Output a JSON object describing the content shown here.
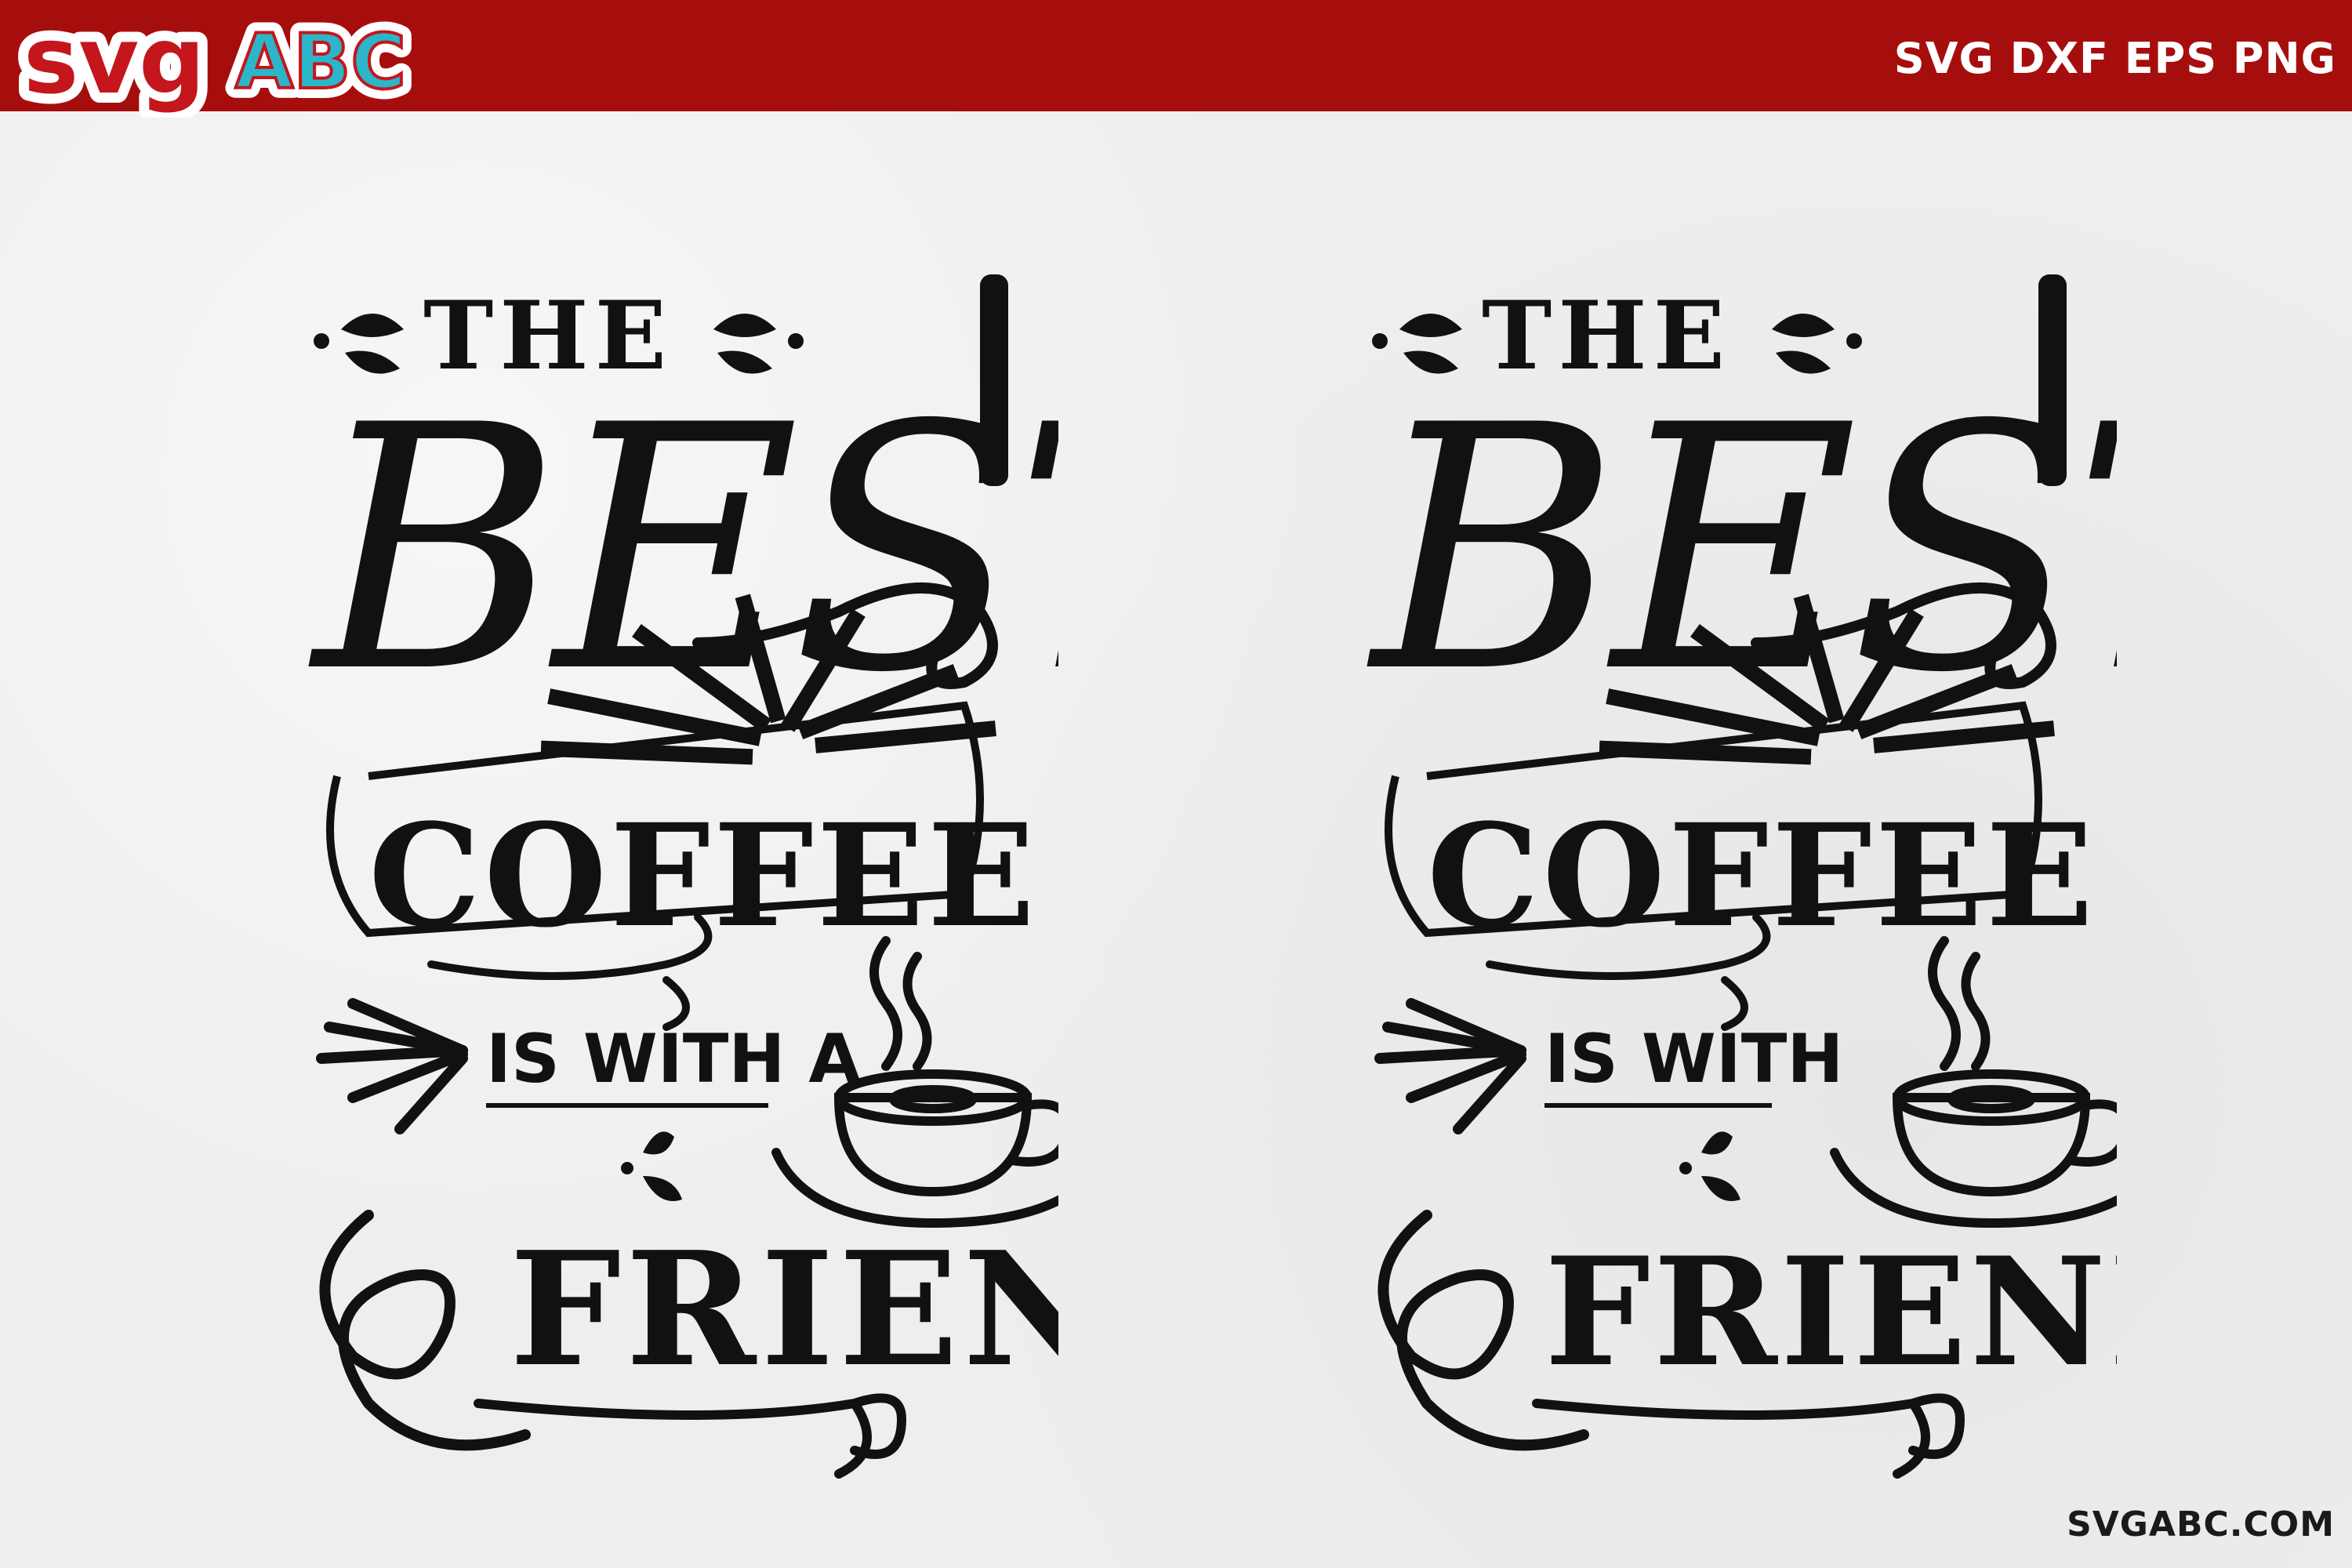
{
  "header": {
    "logo_text_svg": "svg",
    "logo_text_abc": "ABC",
    "formats": "SVG DXF EPS PNG"
  },
  "footer": {
    "site_url": "SVGABC.COM"
  },
  "designs": [
    {
      "the": "THE",
      "best": "BEST",
      "coffee": "COFFEE",
      "is_with": "IS WITH A",
      "friend": "FRIEND"
    },
    {
      "the": "THE",
      "best": "BEST",
      "coffee": "COFFEE",
      "is_with": "IS WITH",
      "friend": "FRIENDS"
    }
  ],
  "colors": {
    "header_red": "#a60e0e",
    "logo_red": "#c4161c",
    "logo_teal": "#2bb6c9",
    "ink": "#111111",
    "paper": "#eeeeee"
  },
  "icons": [
    "coffee-cup-icon",
    "sunburst-rays",
    "swirl-ornament",
    "arrow-rays"
  ]
}
